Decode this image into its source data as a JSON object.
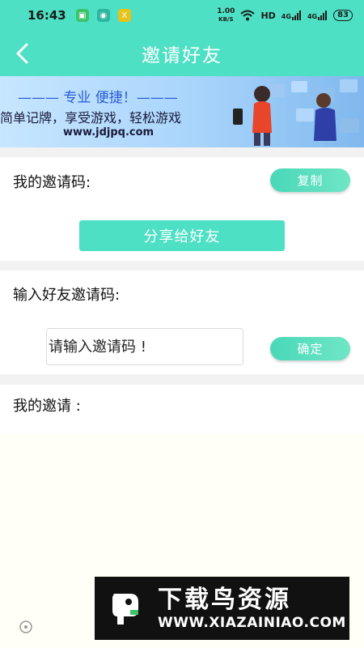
{
  "status_bar": {
    "time": "16:43",
    "net_speed_value": "1.00",
    "net_speed_unit": "KB/S",
    "hd": "HD",
    "signal1": "4G",
    "signal2": "4G",
    "battery": "83"
  },
  "header": {
    "title": "邀请好友",
    "back_icon": "chevron-left-icon"
  },
  "banner": {
    "line1": "——— 专业  便捷！———",
    "line2": "简单记牌，享受游戏，轻松游戏",
    "line3": "www.jdjpq.com"
  },
  "my_code": {
    "label": "我的邀请码:",
    "copy_button": "复制",
    "share_button": "分享给好友"
  },
  "enter_code": {
    "label": "输入好友邀请码:",
    "placeholder": "请输入邀请码 !",
    "confirm_button": "确定"
  },
  "my_invites": {
    "label": "我的邀请 :"
  },
  "watermark": {
    "title": "下载鸟资源",
    "url": "WWW.XIAZAINIAO.COM"
  },
  "colors": {
    "accent": "#4ee0c4",
    "pill_gradient_start": "#49d8b8",
    "pill_gradient_end": "#6fe6c6",
    "background": "#f2f2f2"
  }
}
